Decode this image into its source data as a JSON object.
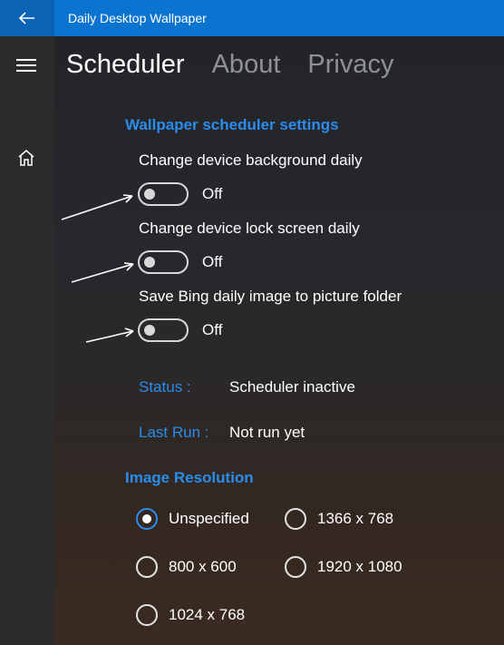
{
  "window": {
    "title": "Daily Desktop Wallpaper"
  },
  "nav": {
    "back_icon": "back-arrow-icon",
    "menu_icon": "hamburger-icon",
    "home_icon": "home-icon"
  },
  "tabs": [
    {
      "label": "Scheduler",
      "active": true
    },
    {
      "label": "About",
      "active": false
    },
    {
      "label": "Privacy",
      "active": false
    }
  ],
  "scheduler": {
    "section_title": "Wallpaper scheduler settings",
    "settings": [
      {
        "label": "Change device background daily",
        "state": "Off"
      },
      {
        "label": "Change device lock screen daily",
        "state": "Off"
      },
      {
        "label": "Save Bing daily image to picture folder",
        "state": "Off"
      }
    ],
    "status_label": "Status :",
    "status_value": "Scheduler inactive",
    "lastrun_label": "Last Run :",
    "lastrun_value": "Not run yet"
  },
  "resolution": {
    "section_title": "Image Resolution",
    "options": [
      {
        "label": "Unspecified",
        "checked": true
      },
      {
        "label": "1366 x 768",
        "checked": false
      },
      {
        "label": "800 x 600",
        "checked": false
      },
      {
        "label": "1920 x 1080",
        "checked": false
      },
      {
        "label": "1024 x 768",
        "checked": false
      }
    ]
  },
  "colors": {
    "accent": "#0b74d1",
    "link": "#2b8ceb"
  }
}
